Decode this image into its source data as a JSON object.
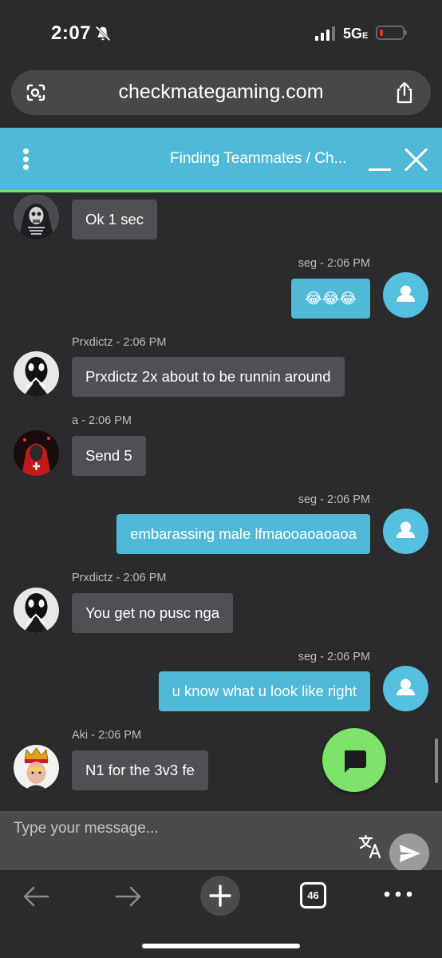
{
  "status_bar": {
    "time": "2:07",
    "network": "5G",
    "network_suffix": "E"
  },
  "browser": {
    "url": "checkmategaming.com",
    "tab_count": "46"
  },
  "chat": {
    "title": "Finding Teammates / Ch...",
    "input_placeholder": "Type your message...",
    "messages": [
      {
        "from": "other",
        "sender": "",
        "time": "",
        "text": "Ok 1 sec",
        "avatar": "skeleton-avatar"
      },
      {
        "from": "self",
        "sender": "seg - 2:06 PM",
        "text": "😂😂😂",
        "avatar": "user-avatar"
      },
      {
        "from": "other",
        "sender": "Prxdictz - 2:06 PM",
        "text": "Prxdictz 2x about to be runnin around",
        "avatar": "mask-avatar"
      },
      {
        "from": "other",
        "sender": "a - 2:06 PM",
        "text": "Send 5",
        "avatar": "red-hood-avatar"
      },
      {
        "from": "self",
        "sender": "seg - 2:06 PM",
        "text": "embarassing male lfmaooaoaoaoa",
        "avatar": "user-avatar"
      },
      {
        "from": "other",
        "sender": "Prxdictz - 2:06 PM",
        "text": "You get no pusc nga",
        "avatar": "mask-avatar"
      },
      {
        "from": "self",
        "sender": "seg - 2:06 PM",
        "text": "u know what u look like right",
        "avatar": "user-avatar"
      },
      {
        "from": "other",
        "sender": "Aki - 2:06 PM",
        "text": "N1 for the 3v3 fe",
        "avatar": "crown-avatar"
      }
    ]
  },
  "colors": {
    "accent": "#4fb9d7",
    "green": "#7ee36a",
    "bubble_other": "#505054",
    "background": "#2b2b2d"
  }
}
